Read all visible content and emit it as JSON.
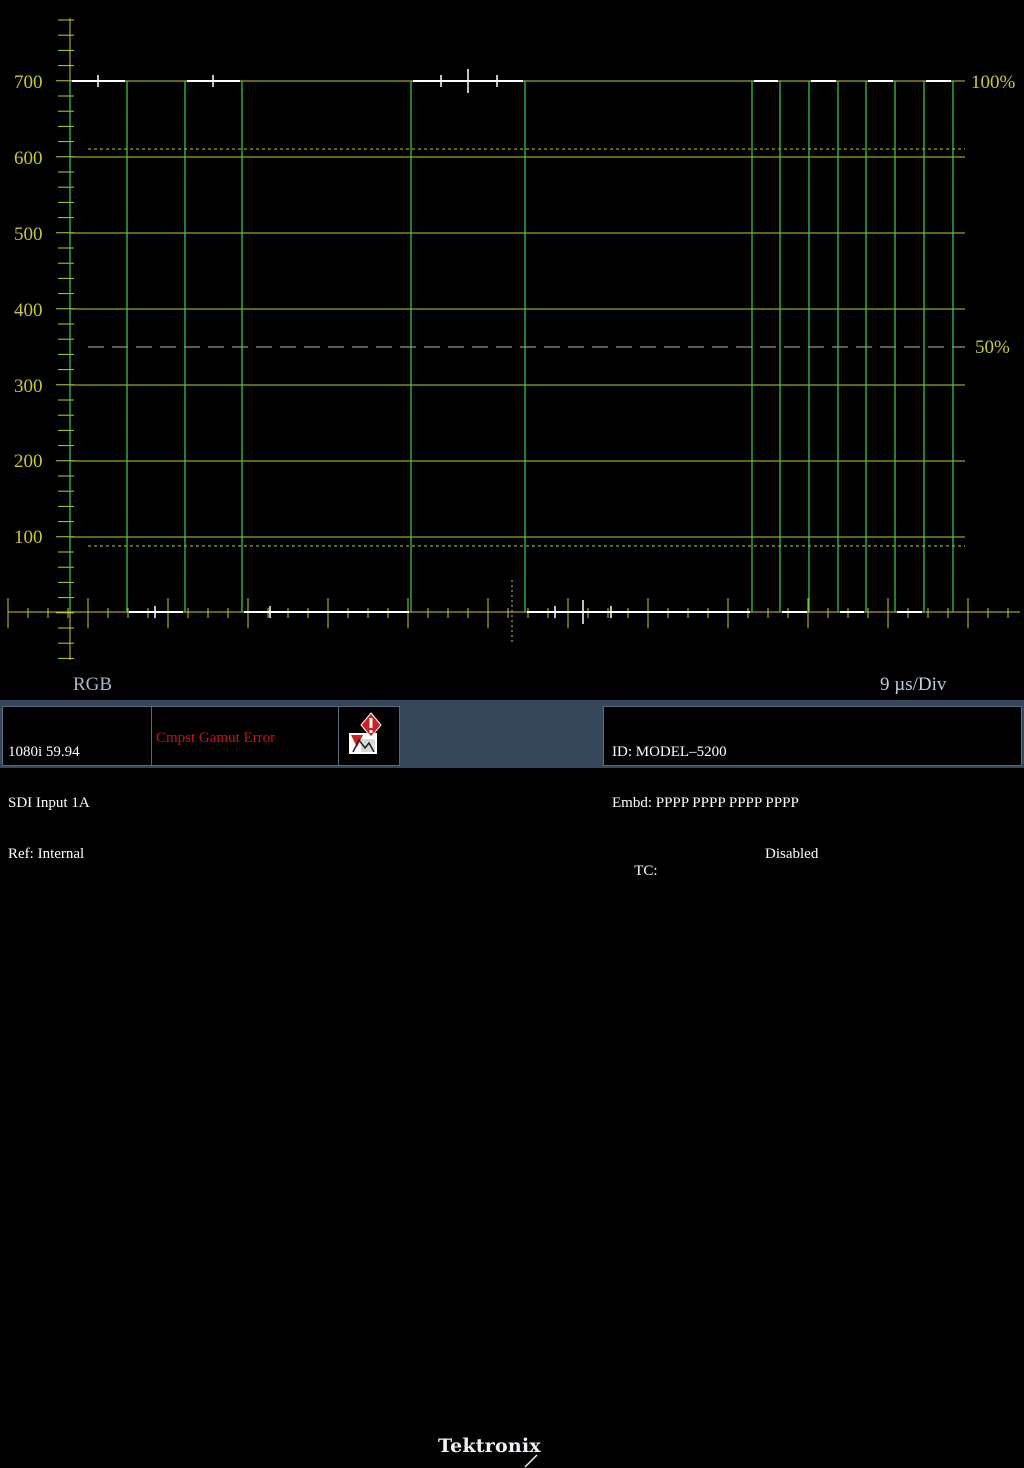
{
  "waveform": {
    "y_axis_labels": [
      "700",
      "600",
      "500",
      "400",
      "300",
      "200",
      "100"
    ],
    "percent_labels": {
      "top": "100%",
      "mid": "50%"
    },
    "mode_label": "RGB",
    "time_scale": "9 µs/Div"
  },
  "status": {
    "format_lines": [
      "1080i 59.94",
      "SDI Input 1A",
      "Ref: Internal"
    ],
    "error_text": "Cmpst Gamut Error",
    "logo_text": "Tektronix",
    "id_line": "ID: MODEL–5200",
    "embd_line": "Embd: PPPP PPPP PPPP PPPP",
    "tc_label": "TC:",
    "tc_value": "Disabled"
  },
  "colors": {
    "graticule": "#c8c832",
    "trace": "#39d24a",
    "trace_white": "#ffffff",
    "error": "#cc1111",
    "label": "#a8b8c8"
  },
  "icons": {
    "alarm": "gamut-alarm-icon"
  }
}
